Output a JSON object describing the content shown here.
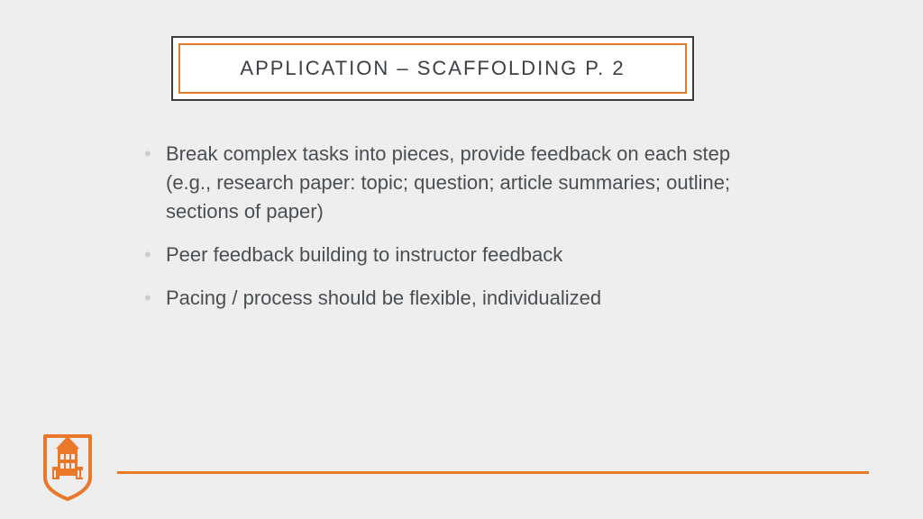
{
  "title": "APPLICATION – SCAFFOLDING P. 2",
  "bullets": [
    "Break complex tasks into pieces, provide feedback on each step (e.g., research paper: topic; question; article summaries; outline; sections of paper)",
    "Peer feedback building to instructor feedback",
    "Pacing / process should be flexible, individualized"
  ],
  "colors": {
    "accent": "#e97829",
    "frame": "#3a3f44",
    "text": "#4a4f54",
    "bullet": "#c9cbcc",
    "bg": "#eeeeee"
  }
}
